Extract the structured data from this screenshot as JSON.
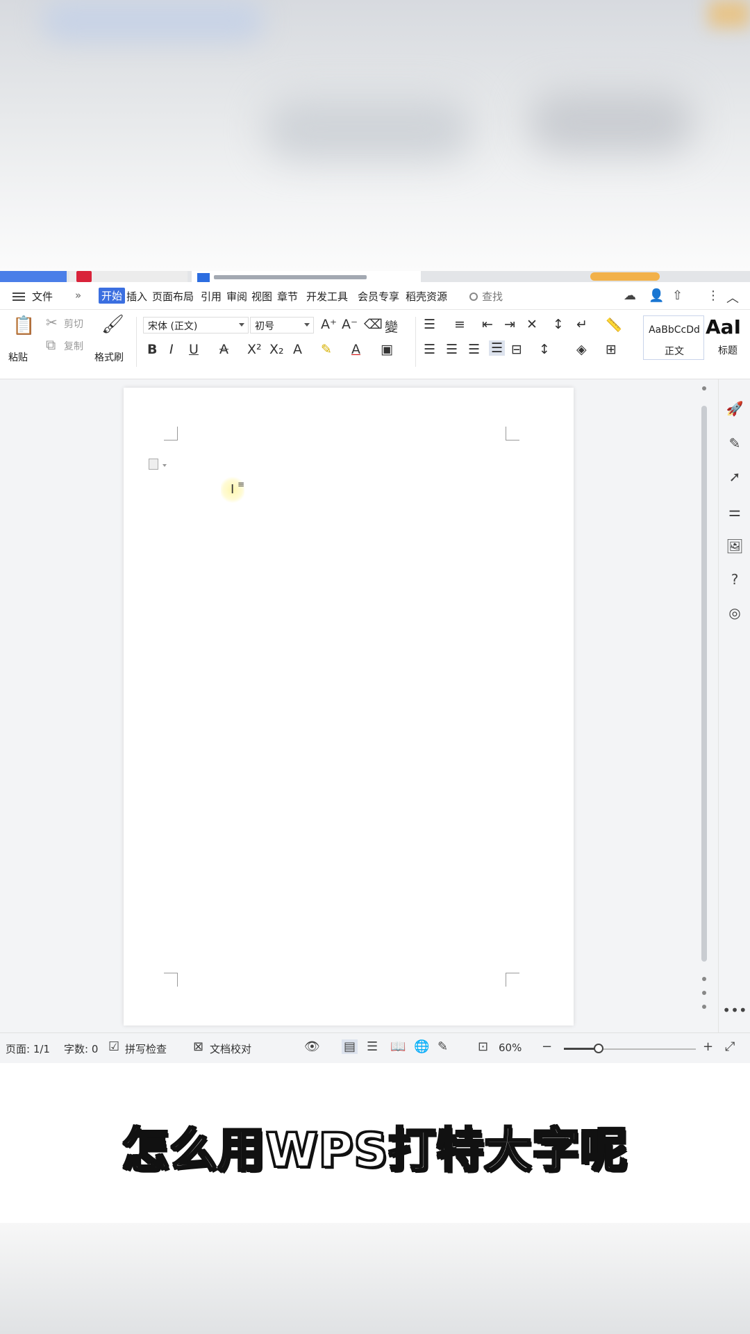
{
  "menubar": {
    "file": "文件",
    "more": "»",
    "tabs": [
      "开始",
      "插入",
      "页面布局",
      "引用",
      "审阅",
      "视图",
      "章节",
      "开发工具",
      "会员专享",
      "稻壳资源"
    ],
    "search": "查找"
  },
  "ribbon": {
    "paste": "粘贴",
    "cut": "剪切",
    "copy": "复制",
    "format_painter": "格式刷",
    "font_name": "宋体 (正文)",
    "font_size": "初号",
    "style_normal_sample": "AaBbCcDd",
    "style_normal_name": "正文",
    "style_heading_sample": "AaI",
    "style_heading_name": "标题"
  },
  "statusbar": {
    "page": "页面: 1/1",
    "word_count": "字数: 0",
    "spell_check": "拼写检查",
    "doc_proof": "文档校对",
    "zoom": "60%"
  },
  "caption": "怎么用WPS打特大字呢",
  "colors": {
    "accent": "#3b6fe0",
    "caption_fill": "#ffffff",
    "caption_stroke": "#111111"
  }
}
